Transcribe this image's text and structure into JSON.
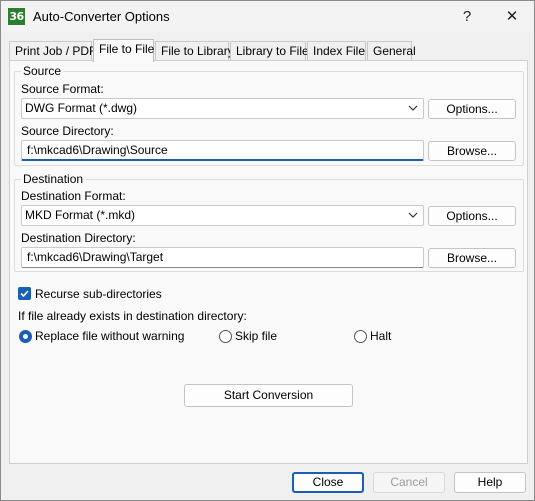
{
  "window": {
    "icon_text": "36",
    "title": "Auto-Converter Options",
    "help_glyph": "?",
    "close_glyph": "✕"
  },
  "tabs": [
    {
      "label": "Print Job / PDF",
      "active": false
    },
    {
      "label": "File to File",
      "active": true
    },
    {
      "label": "File to Library",
      "active": false
    },
    {
      "label": "Library to File",
      "active": false
    },
    {
      "label": "Index File",
      "active": false
    },
    {
      "label": "General",
      "active": false
    }
  ],
  "source": {
    "group_title": "Source",
    "format_label": "Source Format:",
    "format_value": "DWG Format (*.dwg)",
    "options_button": "Options...",
    "directory_label": "Source Directory:",
    "directory_value": "f:\\mkcad6\\Drawing\\Source",
    "browse_button": "Browse..."
  },
  "destination": {
    "group_title": "Destination",
    "format_label": "Destination Format:",
    "format_value": "MKD Format (*.mkd)",
    "options_button": "Options...",
    "directory_label": "Destination Directory:",
    "directory_value": "f:\\mkcad6\\Drawing\\Target",
    "browse_button": "Browse..."
  },
  "recurse": {
    "label": "Recurse sub-directories",
    "checked": true
  },
  "exists": {
    "prompt": "If file already exists in destination directory:",
    "options": [
      {
        "label": "Replace file without warning",
        "checked": true
      },
      {
        "label": "Skip file",
        "checked": false
      },
      {
        "label": "Halt",
        "checked": false
      }
    ]
  },
  "start_button": "Start Conversion",
  "footer": {
    "close": "Close",
    "cancel": "Cancel",
    "help": "Help"
  },
  "colors": {
    "accent": "#1a5fb4",
    "window_bg": "#f0f0f0",
    "panel_bg": "#f9f9f9"
  }
}
